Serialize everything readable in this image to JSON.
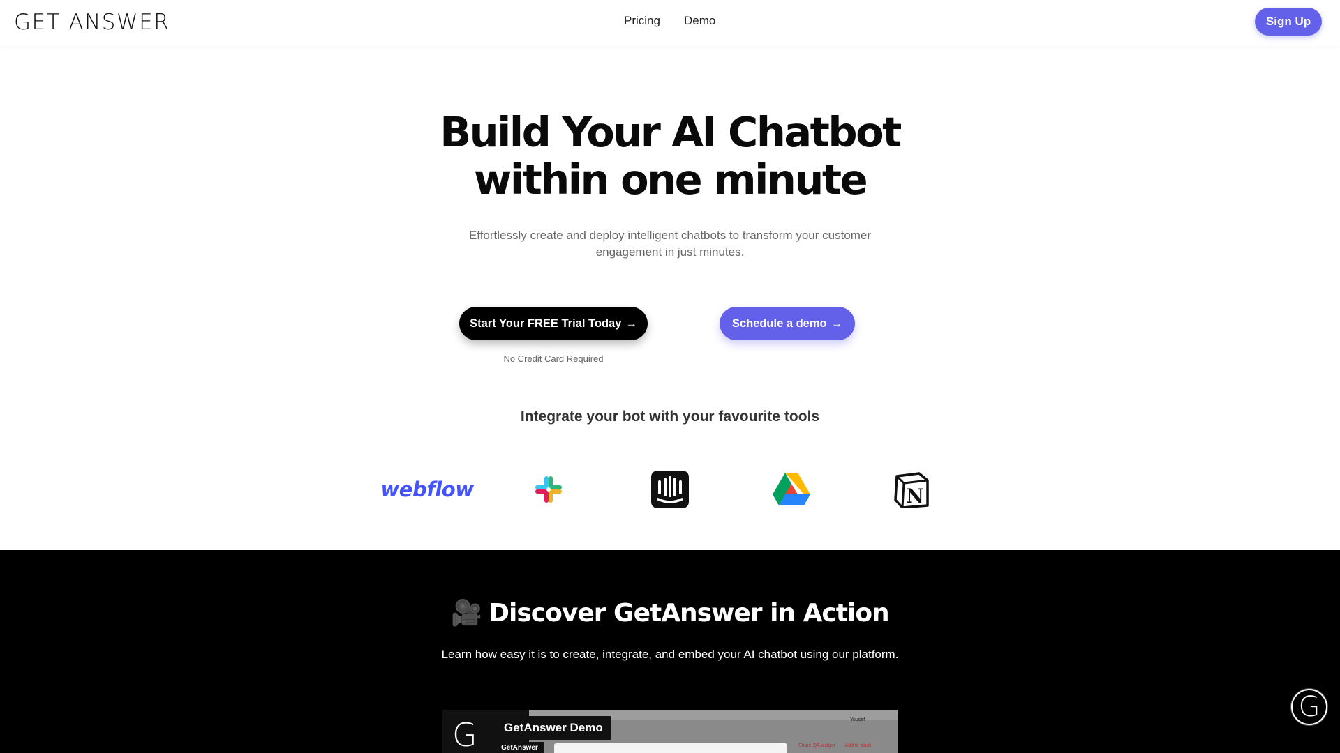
{
  "header": {
    "logo": "GET ANSWER",
    "nav": [
      "Pricing",
      "Demo"
    ],
    "signup_label": "Sign Up"
  },
  "hero": {
    "title_line1": "Build Your AI Chatbot",
    "title_line2": "within one minute",
    "subtitle": "Effortlessly create and deploy intelligent chatbots to transform your customer engagement in just minutes.",
    "trial_label": "Start Your FREE Trial Today",
    "demo_label": "Schedule a demo",
    "arrow": "→",
    "no_credit": "No Credit Card Required",
    "integrate_heading": "Integrate your bot with your favourite tools"
  },
  "tools": {
    "webflow": "webflow",
    "icons": [
      "slack-icon",
      "intercom-icon",
      "google-drive-icon",
      "notion-icon"
    ],
    "notion_letter": "N"
  },
  "action_section": {
    "emoji": "🎥",
    "title": "Discover GetAnswer in Action",
    "subtitle": "Learn how easy it is to create, integrate, and embed your AI chatbot using our platform."
  },
  "video": {
    "logo_letter": "G",
    "title": "GetAnswer Demo",
    "channel": "GetAnswer",
    "link_share": "Share QA widget",
    "link_slack": "Add to slack",
    "user": "Yousef"
  },
  "widget": {
    "letter": "G"
  },
  "colors": {
    "accent": "#6360ea",
    "webflow": "#4353ff",
    "dark_bg": "#000000"
  }
}
